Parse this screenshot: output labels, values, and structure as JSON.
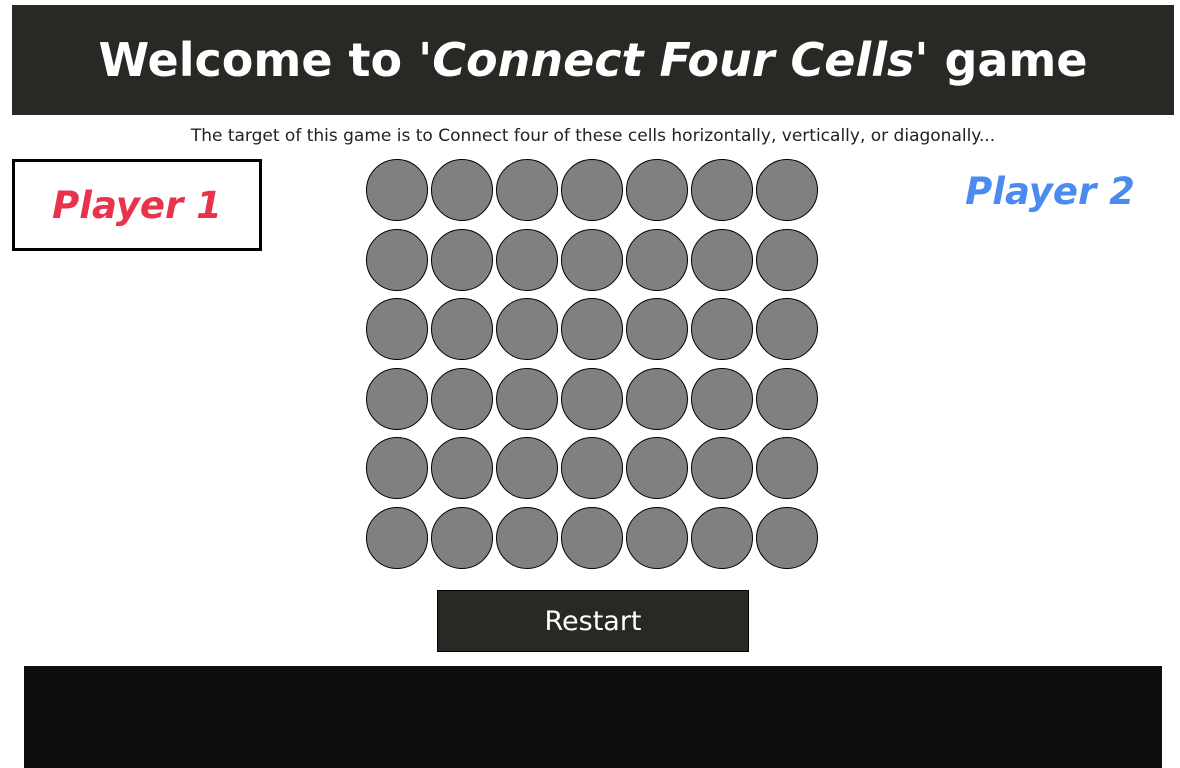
{
  "header": {
    "title_prefix": "Welcome to '",
    "title_game": "Connect Four Cells",
    "title_suffix": "' game"
  },
  "subtitle": "The target of this game is to Connect four of these cells horizontally, vertically, or diagonally...",
  "players": {
    "player1": "Player 1",
    "player2": "Player 2"
  },
  "board": {
    "rows": 6,
    "columns": 7,
    "empty_color": "#808080"
  },
  "restart_label": "Restart",
  "colors": {
    "header_bg": "#2a2825",
    "player1": "#e8334a",
    "player2": "#4b8bf0",
    "footer_bg": "#0f0e0d"
  }
}
